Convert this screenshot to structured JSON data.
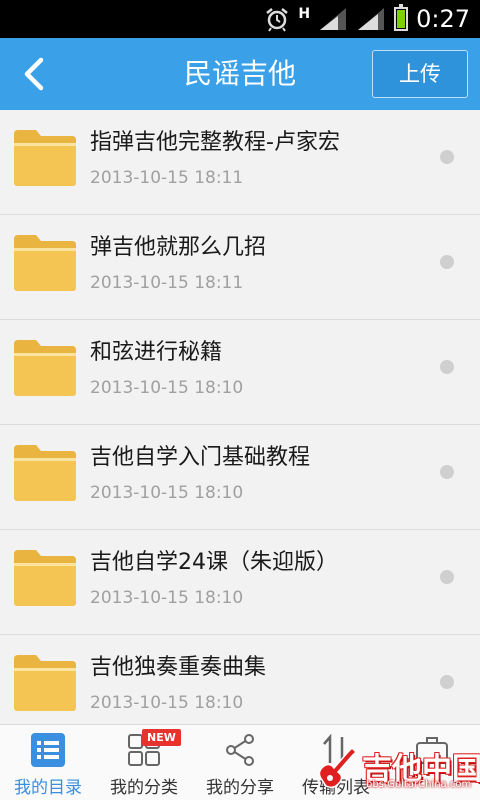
{
  "status_bar": {
    "network_type": "H",
    "time": "0:27",
    "icons": [
      "alarm-icon",
      "signal-icon",
      "signal-icon",
      "battery-icon"
    ]
  },
  "header": {
    "title": "民谣吉他",
    "upload_label": "上传",
    "accent_color": "#3aa0e8"
  },
  "files": [
    {
      "name": "指弹吉他完整教程-卢家宏",
      "date": "2013-10-15  18:11"
    },
    {
      "name": "弹吉他就那么几招",
      "date": "2013-10-15  18:11"
    },
    {
      "name": "和弦进行秘籍",
      "date": "2013-10-15  18:10"
    },
    {
      "name": "吉他自学入门基础教程",
      "date": "2013-10-15  18:10"
    },
    {
      "name": "吉他自学24课（朱迎版）",
      "date": "2013-10-15  18:10"
    },
    {
      "name": "吉他独奏重奏曲集",
      "date": "2013-10-15  18:10"
    }
  ],
  "bottom_nav": {
    "tabs": [
      {
        "label": "我的目录",
        "icon": "list-icon",
        "active": true
      },
      {
        "label": "我的分类",
        "icon": "grid-icon",
        "badge": "NEW"
      },
      {
        "label": "我的分享",
        "icon": "share-icon"
      },
      {
        "label": "传输列表",
        "icon": "transfer-icon"
      },
      {
        "label": "",
        "icon": "briefcase-icon"
      }
    ]
  },
  "watermark": {
    "text": "吉他中国",
    "url": "bbs.GuitarChina.com"
  }
}
